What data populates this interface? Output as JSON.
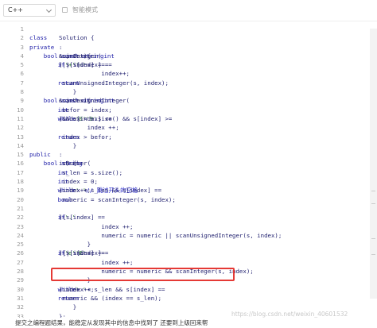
{
  "toolbar": {
    "language": "C++",
    "mode_label": "智能模式"
  },
  "editor": {
    "lines": [
      {
        "num": "1",
        "tokens": [
          {
            "t": "",
            "c": "code"
          }
        ]
      },
      {
        "num": "2",
        "tokens": [
          {
            "t": "class ",
            "c": "kw"
          },
          {
            "t": "Solution {",
            "c": "code"
          }
        ]
      },
      {
        "num": "3",
        "tokens": [
          {
            "t": "private",
            "c": "kw"
          },
          {
            "t": ":",
            "c": "code"
          }
        ]
      },
      {
        "num": "4",
        "tokens": [
          {
            "t": "    bool ",
            "c": "kw"
          },
          {
            "t": "scanInteger(",
            "c": "code"
          },
          {
            "t": "const string",
            "c": "kw"
          },
          {
            "t": " s, ",
            "c": "code"
          },
          {
            "t": "int",
            "c": "kw"
          },
          {
            "t": "& index){",
            "c": "code"
          }
        ]
      },
      {
        "num": "5",
        "tokens": [
          {
            "t": "        if",
            "c": "kw"
          },
          {
            "t": "( s[index] == ",
            "c": "code"
          },
          {
            "t": "'+'",
            "c": "str"
          },
          {
            "t": " || s[index] == ",
            "c": "code"
          },
          {
            "t": "'-'",
            "c": "str"
          },
          {
            "t": ")",
            "c": "code"
          }
        ]
      },
      {
        "num": "6",
        "tokens": [
          {
            "t": "            index++;",
            "c": "code"
          }
        ]
      },
      {
        "num": "7",
        "tokens": [
          {
            "t": "        return",
            "c": "kw"
          },
          {
            "t": " scanUnsignedInteger(s, index);",
            "c": "code"
          }
        ]
      },
      {
        "num": "8",
        "tokens": [
          {
            "t": "    }",
            "c": "code"
          }
        ]
      },
      {
        "num": "9",
        "tokens": [
          {
            "t": "    bool ",
            "c": "kw"
          },
          {
            "t": "scanUnsignedInteger(",
            "c": "code"
          },
          {
            "t": "const string",
            "c": "kw"
          },
          {
            "t": " s, ",
            "c": "code"
          },
          {
            "t": "int",
            "c": "kw"
          },
          {
            "t": "& index){",
            "c": "code"
          }
        ]
      },
      {
        "num": "10",
        "tokens": [
          {
            "t": "        int",
            "c": "kw"
          },
          {
            "t": " befor = index;",
            "c": "code"
          }
        ]
      },
      {
        "num": "11",
        "tokens": [
          {
            "t": "        while",
            "c": "kw"
          },
          {
            "t": "(index < s.size() && s[index] >= ",
            "c": "code"
          },
          {
            "t": "'0'",
            "c": "str"
          },
          {
            "t": " && s[index] <= ",
            "c": "code"
          },
          {
            "t": "'9'",
            "c": "str"
          },
          {
            "t": ")",
            "c": "code"
          }
        ]
      },
      {
        "num": "12",
        "tokens": [
          {
            "t": "        index ++;",
            "c": "code"
          }
        ]
      },
      {
        "num": "13",
        "tokens": [
          {
            "t": "        return",
            "c": "kw"
          },
          {
            "t": " index > befor;",
            "c": "code"
          }
        ]
      },
      {
        "num": "14",
        "tokens": [
          {
            "t": "    }",
            "c": "code"
          }
        ]
      },
      {
        "num": "15",
        "tokens": [
          {
            "t": "public",
            "c": "kw"
          },
          {
            "t": ":",
            "c": "code"
          }
        ]
      },
      {
        "num": "16",
        "tokens": [
          {
            "t": "    bool ",
            "c": "kw"
          },
          {
            "t": "isNumber(",
            "c": "code"
          },
          {
            "t": "string",
            "c": "kw"
          },
          {
            "t": " s) {",
            "c": "code"
          }
        ]
      },
      {
        "num": "17",
        "tokens": [
          {
            "t": "        int",
            "c": "kw"
          },
          {
            "t": " s_len = s.size();",
            "c": "code"
          }
        ]
      },
      {
        "num": "18",
        "tokens": [
          {
            "t": "        int",
            "c": "kw"
          },
          {
            "t": " index = 0;",
            "c": "code"
          }
        ]
      },
      {
        "num": "19",
        "tokens": [
          {
            "t": "        while",
            "c": "kw"
          },
          {
            "t": "(index < s_len && s[index] == ",
            "c": "code"
          },
          {
            "t": "' '",
            "c": "str"
          },
          {
            "t": ")index++;       ",
            "c": "code"
          },
          {
            "t": "// 跳过开头的空格",
            "c": "cmt"
          }
        ]
      },
      {
        "num": "20",
        "tokens": [
          {
            "t": "        bool",
            "c": "kw"
          },
          {
            "t": " numeric = scanInteger(s, index);",
            "c": "code"
          }
        ]
      },
      {
        "num": "21",
        "tokens": [
          {
            "t": "",
            "c": "code"
          }
        ]
      },
      {
        "num": "22",
        "tokens": [
          {
            "t": "        if",
            "c": "kw"
          },
          {
            "t": "( s[index] == ",
            "c": "code"
          },
          {
            "t": "'.'",
            "c": "str"
          },
          {
            "t": "){",
            "c": "code"
          }
        ]
      },
      {
        "num": "23",
        "tokens": [
          {
            "t": "            index ++;",
            "c": "code"
          }
        ]
      },
      {
        "num": "24",
        "tokens": [
          {
            "t": "            numeric = numeric || scanUnsignedInteger(s, index);",
            "c": "code"
          }
        ]
      },
      {
        "num": "25",
        "tokens": [
          {
            "t": "        }",
            "c": "code"
          }
        ]
      },
      {
        "num": "26",
        "tokens": [
          {
            "t": "        if",
            "c": "kw"
          },
          {
            "t": "( s[index] == ",
            "c": "code"
          },
          {
            "t": "'e'",
            "c": "str"
          },
          {
            "t": " || s[index]==",
            "c": "code"
          },
          {
            "t": "'E'",
            "c": "str"
          },
          {
            "t": "){",
            "c": "code"
          }
        ]
      },
      {
        "num": "27",
        "tokens": [
          {
            "t": "            index ++;",
            "c": "code"
          }
        ]
      },
      {
        "num": "28",
        "tokens": [
          {
            "t": "            numeric = numeric && scanInteger(s, index);",
            "c": "code"
          }
        ]
      },
      {
        "num": "29",
        "tokens": [
          {
            "t": "        }",
            "c": "code"
          }
        ]
      },
      {
        "num": "30",
        "tokens": [
          {
            "t": "        while",
            "c": "kw"
          },
          {
            "t": "( index < s_len && s[index] == ",
            "c": "code"
          },
          {
            "t": "' '",
            "c": "str"
          },
          {
            "t": ")index ++;",
            "c": "code"
          }
        ]
      },
      {
        "num": "31",
        "tokens": [
          {
            "t": "        return",
            "c": "kw"
          },
          {
            "t": " numeric && (index == s_len);",
            "c": "code"
          }
        ]
      },
      {
        "num": "32",
        "tokens": [
          {
            "t": "    }",
            "c": "code"
          }
        ]
      },
      {
        "num": "33",
        "tokens": [
          {
            "t": "};",
            "c": "code"
          }
        ]
      }
    ]
  },
  "status": {
    "text": "提交之编程题结果，能稳定从发现其中的信息中找到了 还要到上级回来帮"
  },
  "watermark": "https://blog.csdn.net/weixin_40601532"
}
